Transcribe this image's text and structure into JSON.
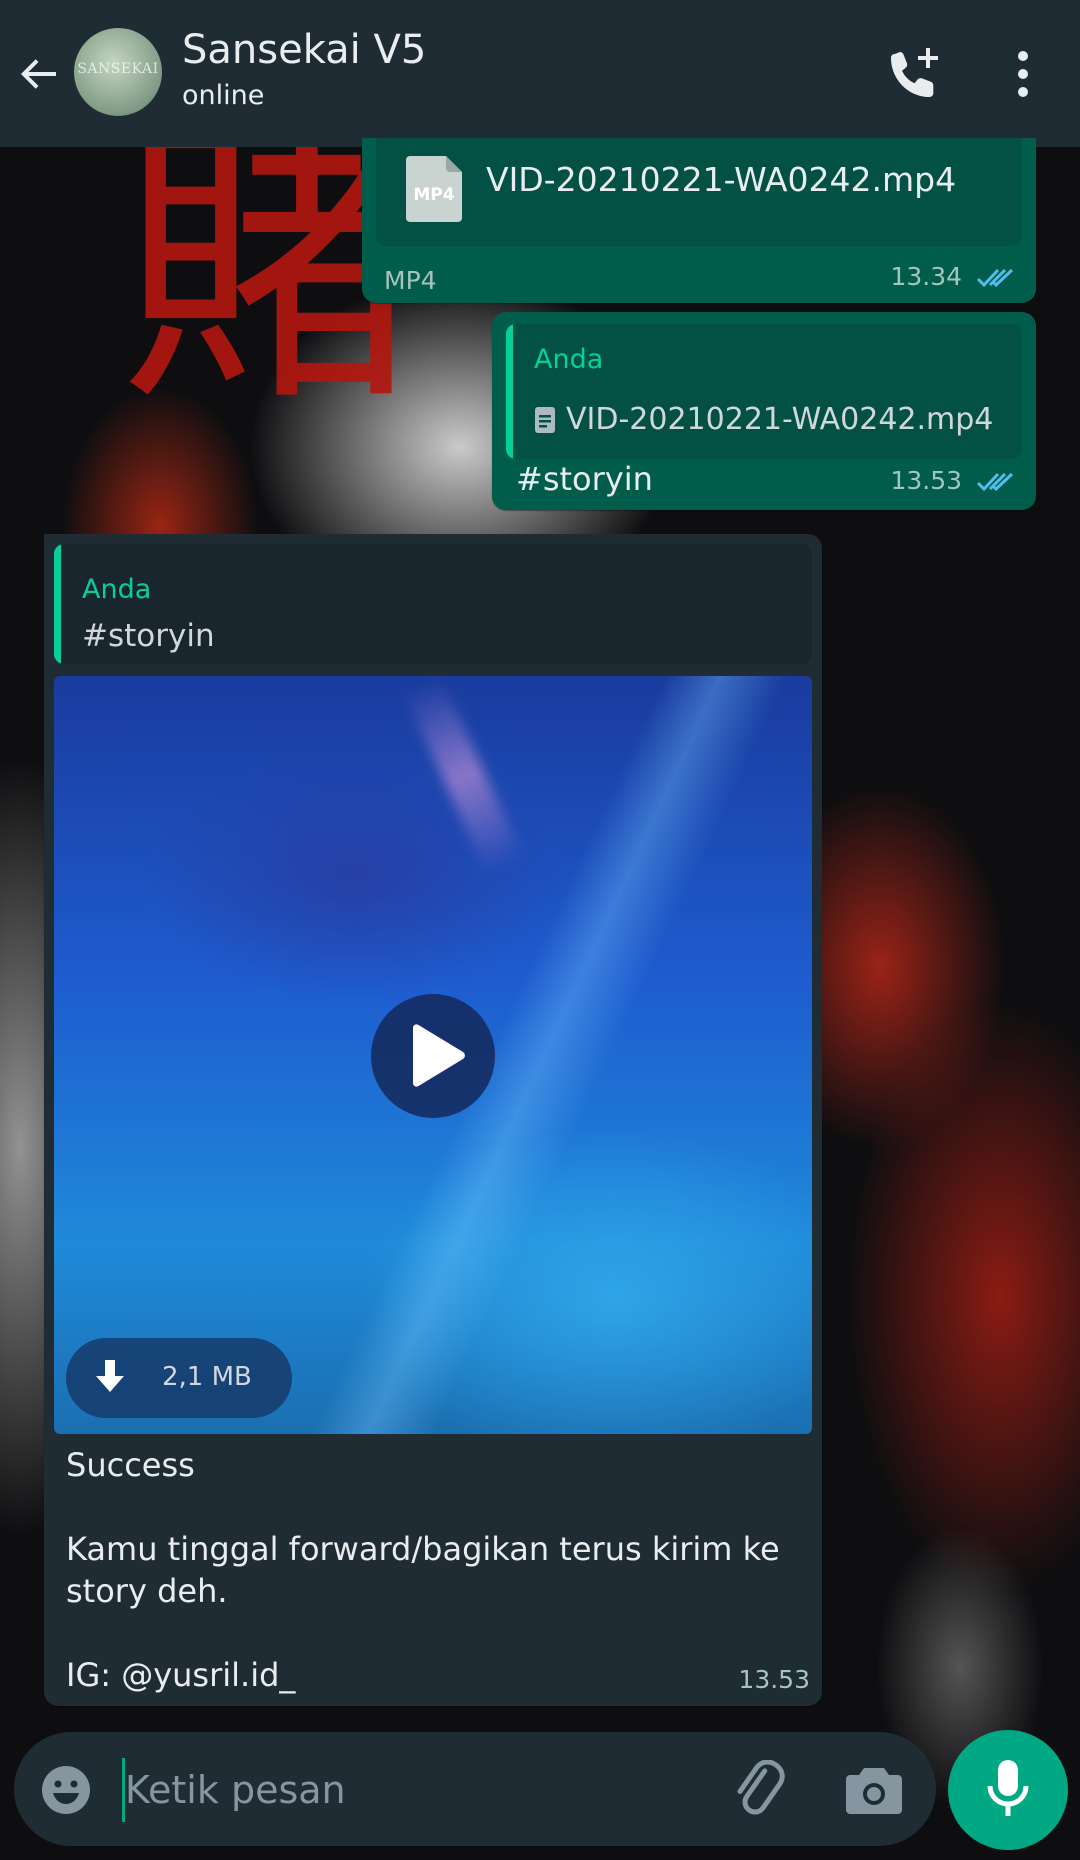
{
  "header": {
    "title": "Sansekai V5",
    "status": "online",
    "avatar_text": "SANSEKAI",
    "icons": [
      "back-arrow-icon",
      "add-call-icon",
      "more-vertical-icon"
    ]
  },
  "messages": [
    {
      "direction": "outgoing",
      "type": "document",
      "file_badge": "MP4",
      "file_name": "VID-20210221-WA0242.mp4",
      "file_type": "MP4",
      "time": "13.34",
      "status": "read"
    },
    {
      "direction": "outgoing",
      "type": "reply",
      "quote_author": "Anda",
      "quote_doc": "VID-20210221-WA0242.mp4",
      "text": "#storyin",
      "time": "13.53",
      "status": "read"
    },
    {
      "direction": "incoming",
      "type": "video",
      "quote_author": "Anda",
      "quote_text": "#storyin",
      "video_size": "2,1 MB",
      "caption_lines": [
        "Success",
        "",
        "Kamu tinggal forward/bagikan terus kirim ke story deh.",
        "",
        "IG: @yusril.id_"
      ],
      "time": "13.53"
    }
  ],
  "input": {
    "placeholder": "Ketik pesan"
  },
  "colors": {
    "header_bg": "#1f2c34",
    "outgoing_bubble": "#005c4b",
    "incoming_bubble": "#1f2c34",
    "accent": "#00a884",
    "read_ticks": "#53bdeb"
  }
}
